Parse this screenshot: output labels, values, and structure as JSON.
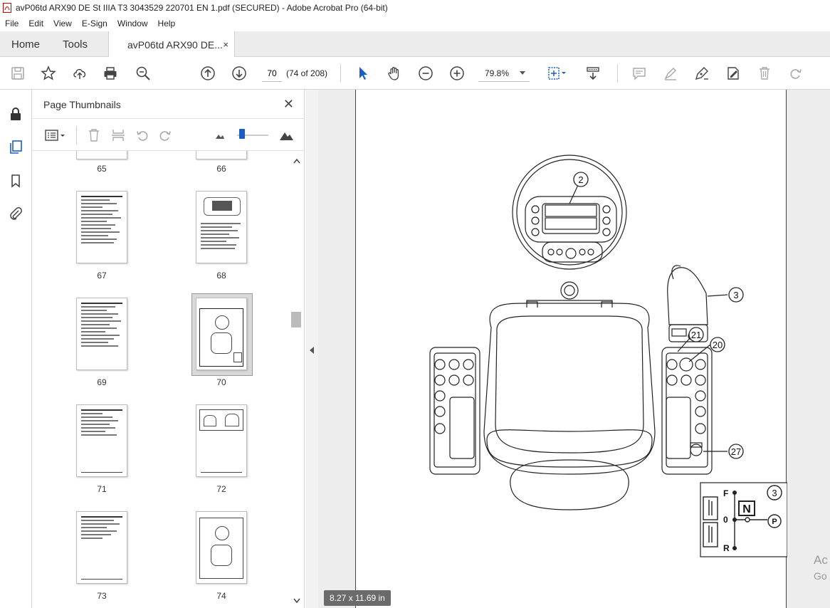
{
  "window": {
    "title": "avP06td ARX90 DE St IIIA T3 3043529 220701 EN 1.pdf (SECURED) - Adobe Acrobat Pro (64-bit)"
  },
  "menu": [
    "File",
    "Edit",
    "View",
    "E-Sign",
    "Window",
    "Help"
  ],
  "tabs": {
    "home": "Home",
    "tools": "Tools",
    "document": "avP06td ARX90 DE...",
    "close": "×"
  },
  "toolbar": {
    "page_number": "70",
    "page_count": "(74 of 208)",
    "zoom": "79.8%"
  },
  "panel": {
    "title": "Page Thumbnails",
    "close": "✕",
    "thumbnails": [
      {
        "label": "65"
      },
      {
        "label": "66"
      },
      {
        "label": "67"
      },
      {
        "label": "68"
      },
      {
        "label": "69"
      },
      {
        "label": "70"
      },
      {
        "label": "71"
      },
      {
        "label": "72"
      },
      {
        "label": "73"
      },
      {
        "label": "74"
      }
    ]
  },
  "viewer": {
    "page_size": "8.27 x 11.69 in",
    "callouts": [
      "2",
      "3",
      "21",
      "20",
      "27"
    ],
    "inset": {
      "number": "3",
      "forward": "F",
      "neutral_pos": "0",
      "reverse": "R",
      "neutral": "N",
      "park": "P"
    },
    "activation_overlay": {
      "line1": "Ac",
      "line2": "Go"
    }
  }
}
